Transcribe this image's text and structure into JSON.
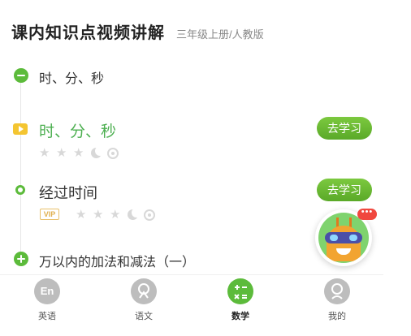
{
  "header": {
    "title": "课内知识点视频讲解",
    "subtitle": "三年级上册/人教版"
  },
  "chapters": [
    {
      "label": "时、分、秒",
      "icon": "collapse-icon"
    },
    {
      "label": "万以内的加法和减法（一）",
      "icon": "expand-icon"
    }
  ],
  "lessons": [
    {
      "title": "时、分、秒",
      "button": "去学习",
      "icon": "play-icon",
      "vip": ""
    },
    {
      "title": "经过时间",
      "button": "去学习",
      "icon": "dot-icon",
      "vip": "VIP"
    }
  ],
  "mascot": {
    "badge": "•••"
  },
  "tabs": [
    {
      "label": "英语",
      "icon_text": "En",
      "icon": "english-icon",
      "active": false
    },
    {
      "label": "语文",
      "icon_text": "",
      "icon": "chinese-icon",
      "active": false
    },
    {
      "label": "数学",
      "icon_text": "",
      "icon": "math-icon",
      "active": true
    },
    {
      "label": "我的",
      "icon_text": "",
      "icon": "profile-icon",
      "active": false
    }
  ],
  "colors": {
    "accent": "#5cbb3b",
    "active_title": "#4caf50",
    "rating_inactive": "#d8d8d8",
    "badge": "#f0473e"
  }
}
